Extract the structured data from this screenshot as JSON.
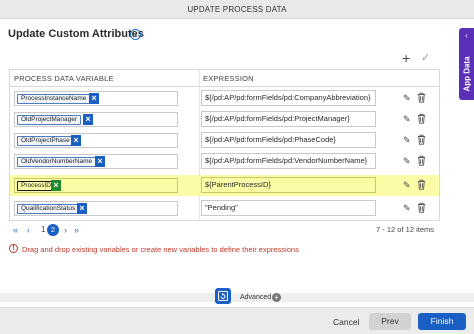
{
  "window": {
    "title": "UPDATE PROCESS DATA"
  },
  "side_tab": {
    "label": "App Data"
  },
  "heading": "Update Custom Attributes",
  "table": {
    "headers": [
      "PROCESS DATA VARIABLE",
      "EXPRESSION"
    ],
    "rows": [
      {
        "variable": "ProcessInstanceName",
        "expression": "${/pd:AP/pd:formFields/pd:CompanyAbbreviation}"
      },
      {
        "variable": "OldProjectManager",
        "expression": "${/pd:AP/pd:formFields/pd:ProjectManager}"
      },
      {
        "variable": "OldProjectPhase",
        "expression": "${/pd:AP/pd:formFields/pd:PhaseCode}"
      },
      {
        "variable": "OldVendorNumberName",
        "expression": "${/pd:AP/pd:formFields/pd:VendorNumberName}"
      },
      {
        "variable": "ProcessID",
        "expression": "${ParentProcessID}",
        "selected": true
      },
      {
        "variable": "QualificationStatus",
        "expression": "\"Pending\""
      }
    ]
  },
  "pager": {
    "first": "«",
    "prev": "‹",
    "page_prev": "1",
    "page_current": "2",
    "next": "›",
    "last": "»",
    "summary": "7 - 12 of 12 items"
  },
  "hint": "Drag and drop existing variables or create new variables to define their expressions",
  "advanced": {
    "label": "Advanced"
  },
  "footer": {
    "cancel": "Cancel",
    "prev": "Prev",
    "finish": "Finish"
  },
  "colors": {
    "accent": "#1a5fc4",
    "side_tab": "#5b2fb8",
    "selected_row": "#fbfca6",
    "selected_remove": "#1e8a2e",
    "hint": "#c0392b"
  },
  "icons": [
    "info-icon",
    "plus-icon",
    "check-icon",
    "remove-icon",
    "pencil-icon",
    "trash-icon",
    "alert-icon",
    "advanced-icon",
    "chevron-left-icon"
  ]
}
